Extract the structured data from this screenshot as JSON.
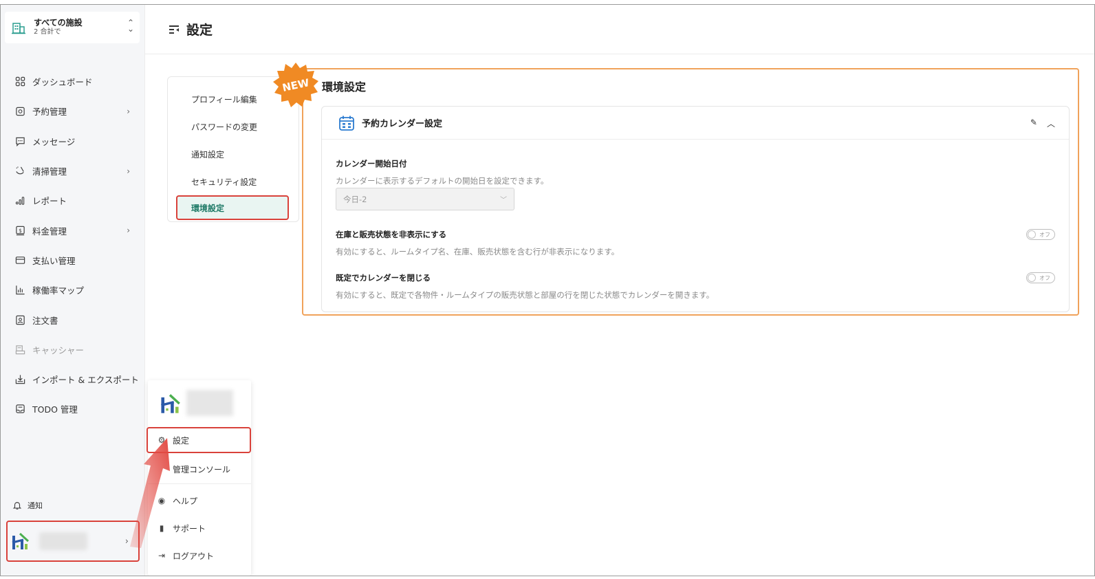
{
  "facility": {
    "name": "すべての施設",
    "count": "2 合計で"
  },
  "sidebar": {
    "items": [
      {
        "label": "ダッシュボード",
        "icon": "dashboard-icon",
        "chevron": false,
        "disabled": false
      },
      {
        "label": "予約管理",
        "icon": "reservation-icon",
        "chevron": true,
        "disabled": false
      },
      {
        "label": "メッセージ",
        "icon": "message-icon",
        "chevron": false,
        "disabled": false
      },
      {
        "label": "清掃管理",
        "icon": "cleaning-icon",
        "chevron": true,
        "disabled": false
      },
      {
        "label": "レポート",
        "icon": "report-icon",
        "chevron": false,
        "disabled": false
      },
      {
        "label": "料金管理",
        "icon": "pricing-icon",
        "chevron": true,
        "disabled": false
      },
      {
        "label": "支払い管理",
        "icon": "payment-icon",
        "chevron": false,
        "disabled": false
      },
      {
        "label": "稼働率マップ",
        "icon": "occupancy-icon",
        "chevron": false,
        "disabled": false
      },
      {
        "label": "注文書",
        "icon": "order-icon",
        "chevron": false,
        "disabled": false
      },
      {
        "label": "キャッシャー",
        "icon": "cashier-icon",
        "chevron": false,
        "disabled": true
      },
      {
        "label": "インポート & エクスポート",
        "icon": "import-export-icon",
        "chevron": false,
        "disabled": false
      },
      {
        "label": "TODO 管理",
        "icon": "todo-icon",
        "chevron": false,
        "disabled": false
      }
    ],
    "notify_label": "通知"
  },
  "popup": {
    "settings": "設定",
    "admin_console": "管理コンソール",
    "help": "ヘルプ",
    "support": "サポート",
    "logout": "ログアウト"
  },
  "header": {
    "title": "設定"
  },
  "submenu": {
    "items": [
      "プロフィール編集",
      "パスワードの変更",
      "通知設定",
      "セキュリティ設定"
    ],
    "active": "環境設定"
  },
  "main": {
    "badge": "NEW",
    "title": "環境設定",
    "card_title": "予約カレンダー設定",
    "start_date_label": "カレンダー開始日付",
    "start_date_desc": "カレンダーに表示するデフォルトの開始日を設定できます。",
    "start_date_value": "今日-2",
    "hide_stock_label": "在庫と販売状態を非表示にする",
    "hide_stock_desc": "有効にすると、ルームタイプ名、在庫、販売状態を含む行が非表示になります。",
    "hide_stock_toggle": "オフ",
    "close_calendar_label": "既定でカレンダーを閉じる",
    "close_calendar_desc": "有効にすると、既定で各物件・ルームタイプの販売状態と部屋の行を閉じた状態でカレンダーを開きます。",
    "close_calendar_toggle": "オフ"
  },
  "colors": {
    "accent": "#2a9d8f",
    "highlight_red": "#d9413a",
    "panel_orange": "#f0a25a",
    "badge_orange": "#f08a24"
  }
}
